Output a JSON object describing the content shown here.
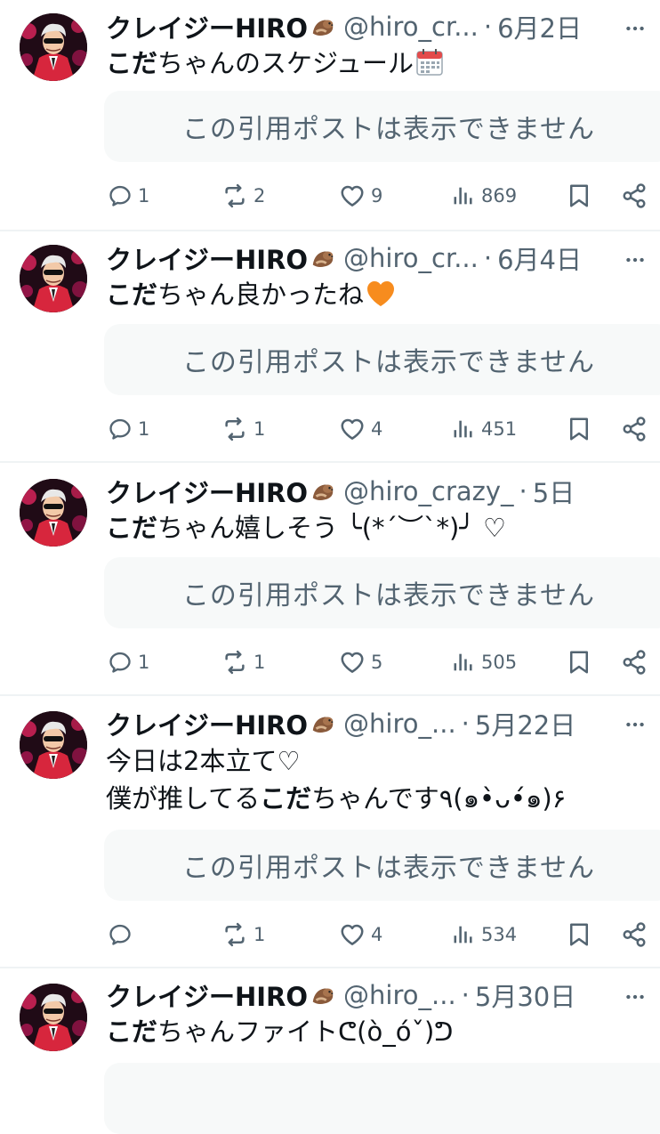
{
  "colors": {
    "text": "#0f1419",
    "secondary": "#536471",
    "quote_bg": "#f7f9f9",
    "divider": "#eff3f4",
    "accent_orange": "#f78c1e"
  },
  "tweets": [
    {
      "name": "クレイジーHIRO",
      "handle": "@hiro_cr...",
      "sep": "·",
      "date": "6月2日",
      "text_bold": "こだ",
      "text_rest": "ちゃんのスケジュール",
      "text_emoji": "calendar-emoji",
      "quote": "この引用ポストは表示できません",
      "replies": "1",
      "reposts": "2",
      "likes": "9",
      "views": "869"
    },
    {
      "name": "クレイジーHIRO",
      "handle": "@hiro_cr...",
      "sep": "·",
      "date": "6月4日",
      "text_bold": "こだ",
      "text_rest": "ちゃん良かったね",
      "text_emoji": "orange-heart-emoji",
      "quote": "この引用ポストは表示できません",
      "replies": "1",
      "reposts": "1",
      "likes": "4",
      "views": "451"
    },
    {
      "name": "クレイジーHIRO",
      "handle": "@hiro_crazy_",
      "sep": "·",
      "date": "5日",
      "text_bold": "こだ",
      "text_rest": "ちゃん嬉しそう ╰(*´︶`*)╯ ♡",
      "quote": "この引用ポストは表示できません",
      "replies": "1",
      "reposts": "1",
      "likes": "5",
      "views": "505"
    },
    {
      "name": "クレイジーHIRO",
      "handle": "@hiro_...",
      "sep": "·",
      "date": "5月22日",
      "text_line1": "今日は2本立て♡",
      "text_line2_pre": "僕が推してる",
      "text_bold": "こだ",
      "text_rest": "ちゃんです٩(๑•̀ᴗ•́๑)۶",
      "quote": "この引用ポストは表示できません",
      "replies": "",
      "reposts": "1",
      "likes": "4",
      "views": "534"
    },
    {
      "name": "クレイジーHIRO",
      "handle": "@hiro_...",
      "sep": "·",
      "date": "5月30日",
      "text_bold": "こだ",
      "text_rest": "ちゃんファイトᕦ(ò_óˇ)ᕤ"
    }
  ]
}
